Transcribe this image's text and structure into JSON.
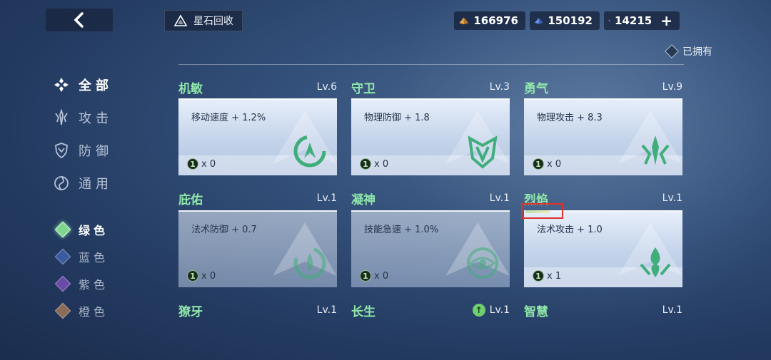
{
  "topbar": {
    "recycle_label": "星石回收",
    "currencies": [
      {
        "icon": "gold-crystal-icon",
        "value": "166976"
      },
      {
        "icon": "blue-crystal-icon",
        "value": "150192"
      },
      {
        "icon": "purple-gem-icon",
        "value": "14215"
      }
    ],
    "add_label": "+"
  },
  "owned_filter": {
    "label": "已拥有"
  },
  "sidebar": {
    "categories": [
      {
        "label": "全部",
        "icon": "all-icon",
        "active": true
      },
      {
        "label": "攻击",
        "icon": "attack-icon",
        "active": false
      },
      {
        "label": "防御",
        "icon": "defense-icon",
        "active": false
      },
      {
        "label": "通用",
        "icon": "general-icon",
        "active": false
      }
    ],
    "colors": [
      {
        "label": "绿色",
        "color": "#7fd68f",
        "active": true
      },
      {
        "label": "蓝色",
        "color": "#4a68b8",
        "active": false
      },
      {
        "label": "紫色",
        "color": "#7a56b8",
        "active": false
      },
      {
        "label": "橙色",
        "color": "#b8845a",
        "active": false
      }
    ]
  },
  "cards": [
    {
      "name": "机敏",
      "level": "Lv.6",
      "stat": "移动速度 + 1.2%",
      "count_badge": "1",
      "count": "x 0",
      "emblem": "agility-emblem-icon"
    },
    {
      "name": "守卫",
      "level": "Lv.3",
      "stat": "物理防御 + 1.8",
      "count_badge": "1",
      "count": "x 0",
      "emblem": "guard-emblem-icon"
    },
    {
      "name": "勇气",
      "level": "Lv.9",
      "stat": "物理攻击 + 8.3",
      "count_badge": "1",
      "count": "x 0",
      "emblem": "courage-emblem-icon"
    },
    {
      "name": "庇佑",
      "level": "Lv.1",
      "stat": "法术防御 + 0.7",
      "count_badge": "1",
      "count": "x 0",
      "emblem": "blessing-emblem-icon"
    },
    {
      "name": "凝神",
      "level": "Lv.1",
      "stat": "技能急速 + 1.0%",
      "count_badge": "1",
      "count": "x 0",
      "emblem": "focus-emblem-icon"
    },
    {
      "name": "烈焰",
      "level": "Lv.1",
      "stat": "法术攻击 + 1.0",
      "count_badge": "1",
      "count": "x 1",
      "emblem": "flame-emblem-icon"
    },
    {
      "name": "獠牙",
      "level": "Lv.1"
    },
    {
      "name": "长生",
      "level": "Lv.1",
      "upgradable": true
    },
    {
      "name": "智慧",
      "level": "Lv.1"
    }
  ]
}
